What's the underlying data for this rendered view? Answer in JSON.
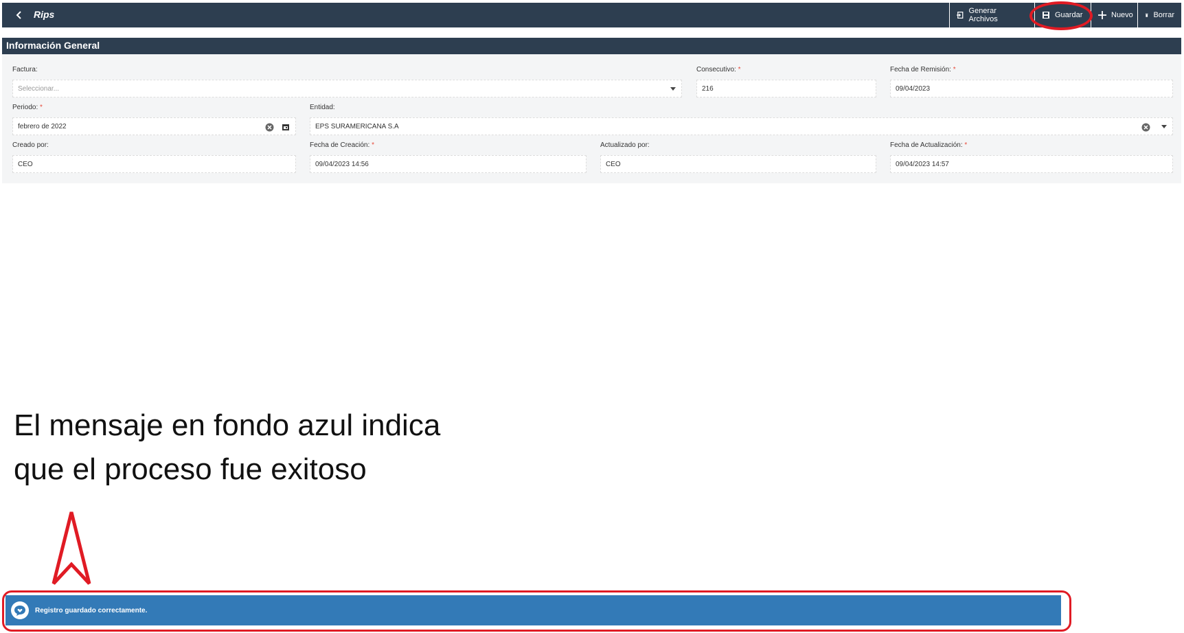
{
  "header": {
    "title": "Rips",
    "back_icon": "chevron-left-icon",
    "actions": [
      {
        "label": "Generar Archivos",
        "icon": "export-icon"
      },
      {
        "label": "Guardar",
        "icon": "save-icon"
      },
      {
        "label": "Nuevo",
        "icon": "plus-icon"
      },
      {
        "label": "Borrar",
        "icon": "trash-icon"
      }
    ]
  },
  "section": {
    "title": "Información General"
  },
  "form": {
    "factura": {
      "label": "Factura:",
      "placeholder": "Seleccionar..."
    },
    "consecutivo": {
      "label": "Consecutivo:",
      "value": "216"
    },
    "fecha_remision": {
      "label": "Fecha de Remisión:",
      "value": "09/04/2023"
    },
    "periodo": {
      "label": "Periodo:",
      "value": "febrero de 2022"
    },
    "entidad": {
      "label": "Entidad:",
      "value": "EPS SURAMERICANA S.A"
    },
    "creado_por": {
      "label": "Creado por:",
      "value": "CEO"
    },
    "fecha_creacion": {
      "label": "Fecha de Creación:",
      "value": "09/04/2023 14:56"
    },
    "actualizado_por": {
      "label": "Actualizado por:",
      "value": "CEO"
    },
    "fecha_actualizacion": {
      "label": "Fecha de Actualización:",
      "value": "09/04/2023 14:57"
    },
    "required_mark": "*"
  },
  "annotation": {
    "line1": "El mensaje en fondo azul indica",
    "line2": "que el proceso fue exitoso"
  },
  "toast": {
    "message": "Registro guardado correctamente.",
    "icon": "chat-bubble-heart-icon"
  },
  "colors": {
    "header_bg": "#2d3e50",
    "toast_bg": "#337ab7",
    "highlight": "#e01b24",
    "required": "#e74c3c"
  }
}
